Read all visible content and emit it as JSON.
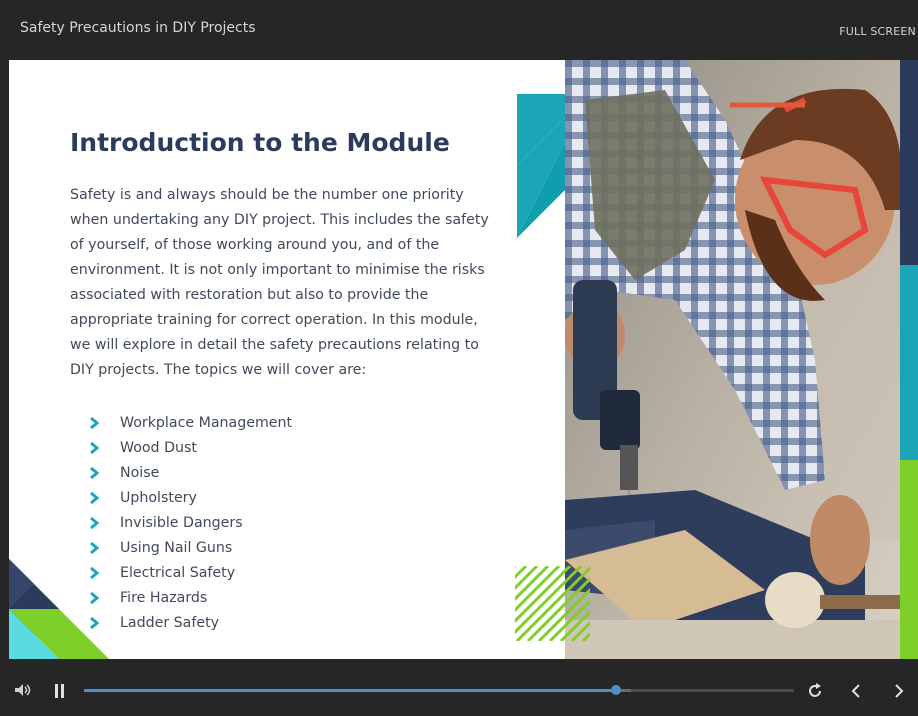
{
  "header": {
    "course_title": "Safety Precautions in DIY Projects",
    "fullscreen_label": "FULL SCREEN"
  },
  "slide": {
    "title": "Introduction to the Module",
    "body": "Safety is and always should be the number one priority when undertaking any DIY project. This includes the safety of yourself, of those working around you, and of the environment. It is not only important to minimise the risks associated with restoration but also to provide the appropriate training for correct operation. In this module, we will explore in detail the safety precautions relating to DIY projects. The topics we will cover are:",
    "topics": [
      "Workplace Management",
      "Wood Dust",
      "Noise",
      "Upholstery",
      "Invisible Dangers",
      "Using Nail Guns",
      "Electrical Safety",
      "Fire Hazards",
      "Ladder Safety"
    ]
  },
  "player": {
    "progress_fraction": 0.749,
    "buffer_fraction": 0.77
  },
  "colors": {
    "accent_teal": "#1aa6b7",
    "accent_cyan": "#5adbe0",
    "accent_green": "#7fcf2b",
    "navy": "#2a3b5c",
    "progress": "#4f8ec9"
  },
  "icons": {
    "volume": "volume-icon",
    "pause": "pause-icon",
    "replay": "replay-icon",
    "prev": "chevron-left-icon",
    "next": "chevron-right-icon",
    "bullet": "chevron-right-icon"
  }
}
